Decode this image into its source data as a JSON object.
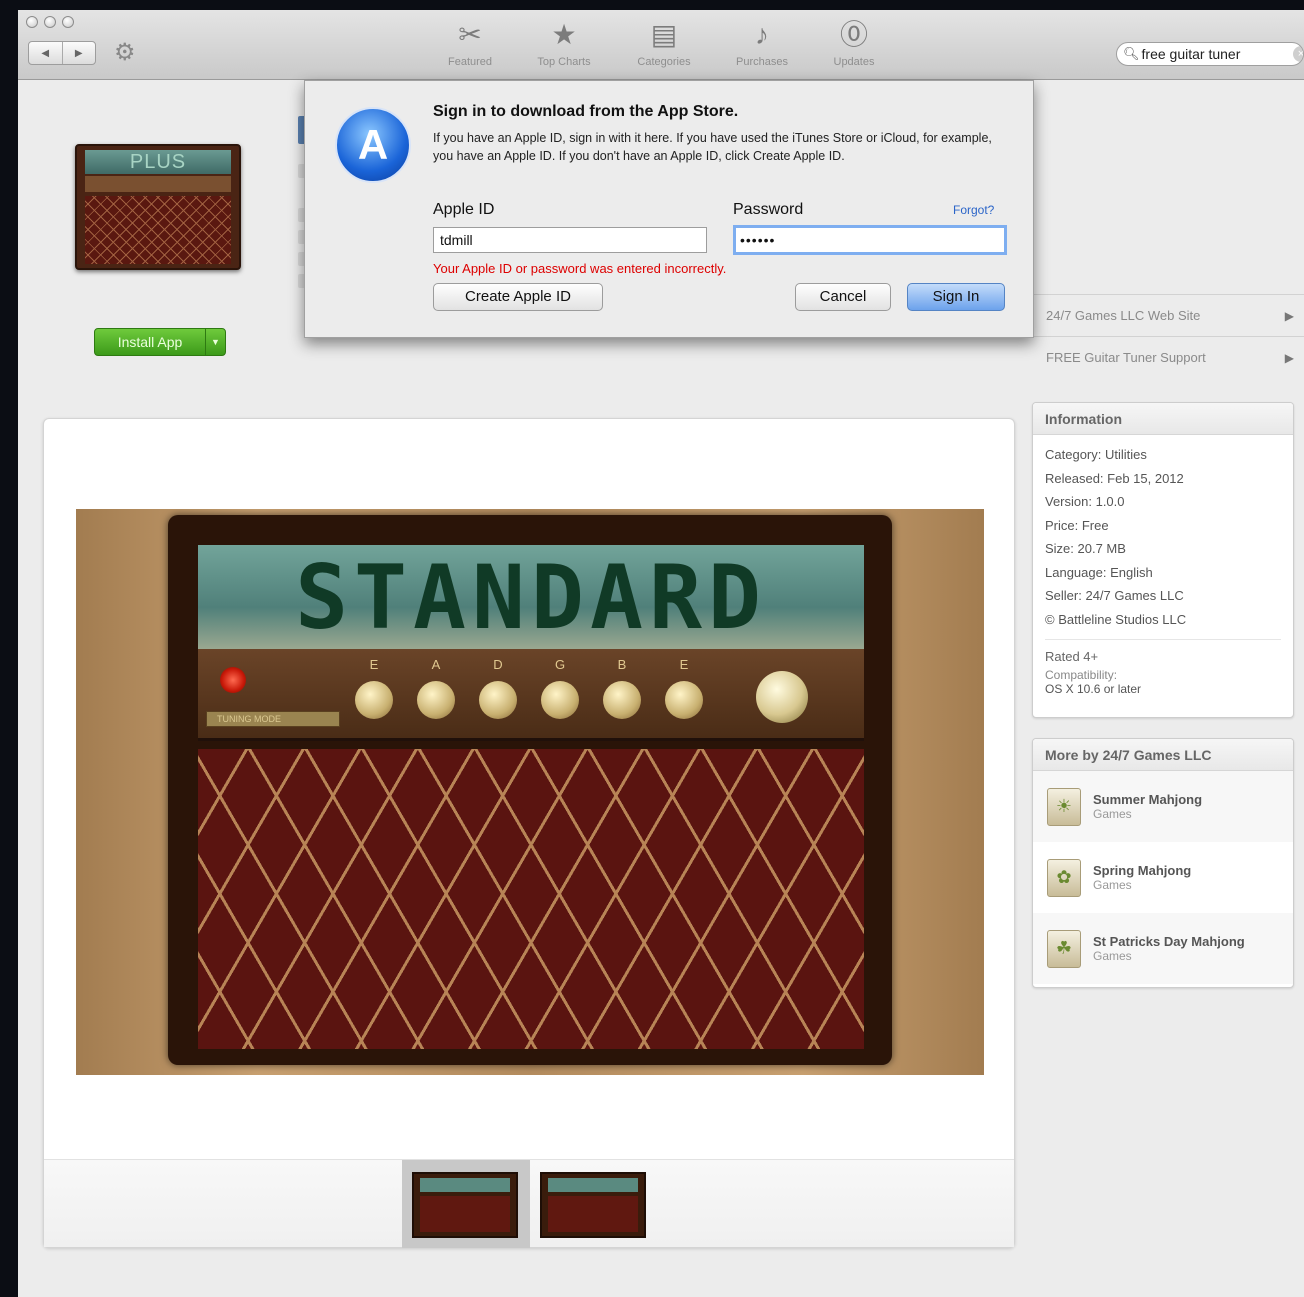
{
  "toolbar": {
    "items": [
      {
        "label": "Featured",
        "icon": "featured-icon"
      },
      {
        "label": "Top Charts",
        "icon": "top-charts-icon"
      },
      {
        "label": "Categories",
        "icon": "categories-icon"
      },
      {
        "label": "Purchases",
        "icon": "purchases-icon"
      },
      {
        "label": "Updates",
        "icon": "updates-icon"
      }
    ],
    "search_value": "free guitar tuner"
  },
  "app": {
    "icon_text": "PLUS",
    "install_label": "Install App"
  },
  "dialog": {
    "title": "Sign in to download from the App Store.",
    "body": "If you have an Apple ID, sign in with it here. If you have used the iTunes Store or iCloud, for example, you have an Apple ID. If you don't have an Apple ID, click Create Apple ID.",
    "apple_id_label": "Apple ID",
    "password_label": "Password",
    "forgot_label": "Forgot?",
    "apple_id_value": "tdmill",
    "password_value": "••••••",
    "error": "Your Apple ID or password was entered incorrectly.",
    "create_label": "Create Apple ID",
    "cancel_label": "Cancel",
    "signin_label": "Sign In"
  },
  "screenshot": {
    "display_text": "STANDARD",
    "strings": [
      "E",
      "A",
      "D",
      "G",
      "B",
      "E"
    ],
    "mode_label": "TUNING MODE"
  },
  "links": [
    "24/7 Games LLC Web Site",
    "FREE Guitar Tuner Support"
  ],
  "information": {
    "title": "Information",
    "rows": [
      "Category: Utilities",
      "Released: Feb 15, 2012",
      "Version: 1.0.0",
      "Price: Free",
      "Size: 20.7 MB",
      "Language: English",
      "Seller: 24/7 Games LLC",
      "© Battleline Studios LLC"
    ],
    "rated": "Rated 4+",
    "compat_label": "Compatibility:",
    "compat_value": "OS X 10.6 or later"
  },
  "more": {
    "title": "More by 24/7 Games LLC",
    "items": [
      {
        "name": "Summer Mahjong",
        "category": "Games"
      },
      {
        "name": "Spring Mahjong",
        "category": "Games"
      },
      {
        "name": "St Patricks Day Mahjong",
        "category": "Games"
      }
    ]
  }
}
